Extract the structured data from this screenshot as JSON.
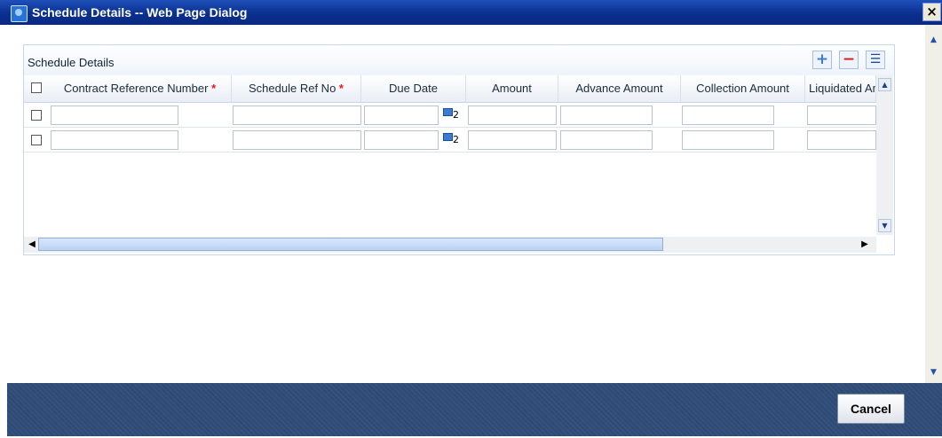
{
  "window": {
    "title": "Schedule Details -- Web Page Dialog",
    "close_glyph": "×"
  },
  "panel": {
    "title": "Schedule Details",
    "toolbar": {
      "add_glyph": "+",
      "delete_glyph": "−",
      "view_glyph": "☰"
    }
  },
  "grid": {
    "columns": [
      {
        "label": "Contract Reference Number",
        "required": true
      },
      {
        "label": "Schedule Ref No",
        "required": true
      },
      {
        "label": "Due Date",
        "required": false
      },
      {
        "label": "Amount",
        "required": false
      },
      {
        "label": "Advance Amount",
        "required": false
      },
      {
        "label": "Collection Amount",
        "required": false
      },
      {
        "label": "Liquidated Amount",
        "required": false
      }
    ],
    "required_marker": "*",
    "calendar_glyph": "2",
    "rows": [
      {
        "checked": false,
        "cells": [
          "",
          "",
          "",
          "",
          "",
          "",
          ""
        ]
      },
      {
        "checked": false,
        "cells": [
          "",
          "",
          "",
          "",
          "",
          "",
          ""
        ]
      }
    ]
  },
  "footer": {
    "cancel_label": "Cancel"
  },
  "icons": {
    "title_icon": "ie-page-icon",
    "calendar": "calendar-icon",
    "add": "plus-icon",
    "delete": "minus-icon",
    "view": "list-view-icon"
  }
}
